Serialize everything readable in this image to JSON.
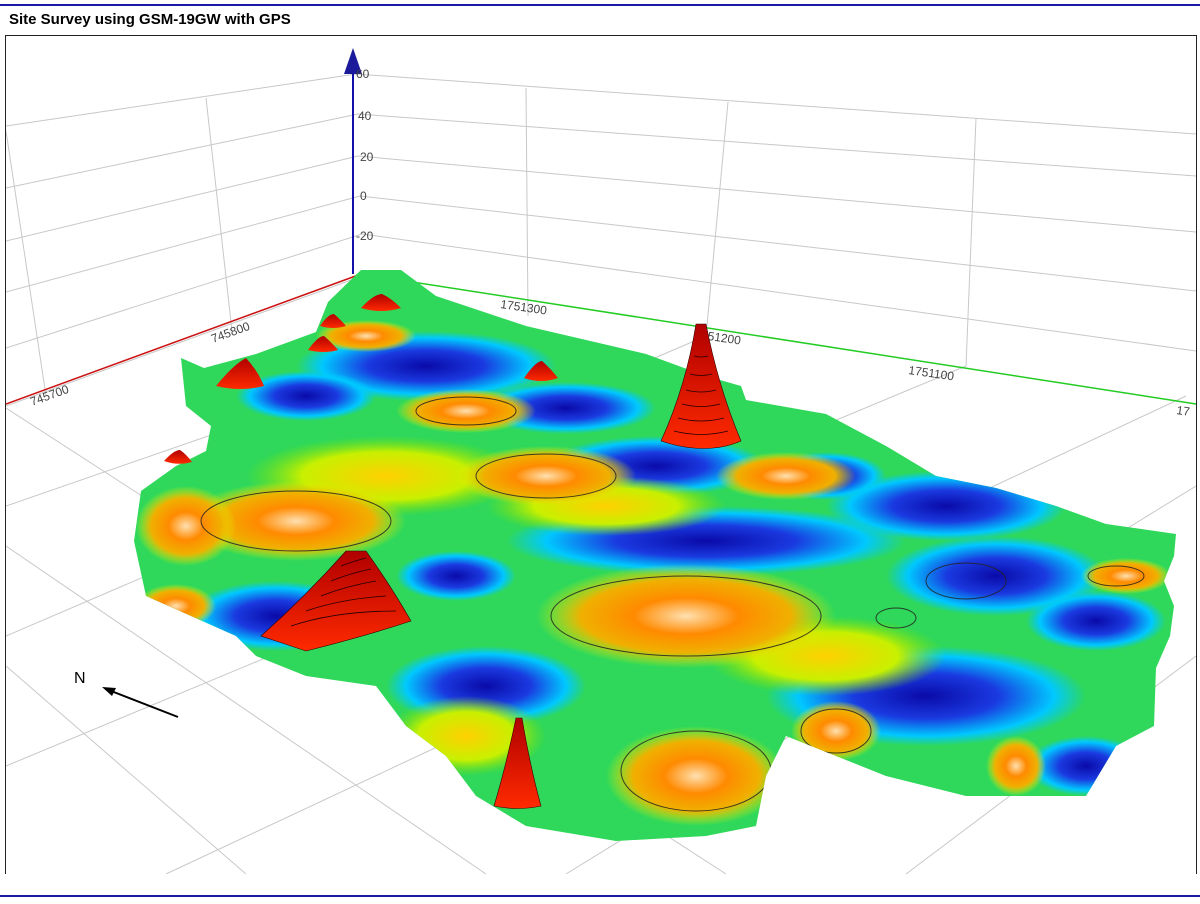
{
  "window": {
    "title": "Site Survey using GSM-19GW with GPS"
  },
  "plot3d": {
    "z_ticks": [
      "60",
      "40",
      "20",
      "0",
      "-20"
    ],
    "x_ticks": [
      "745700",
      "745800"
    ],
    "y_ticks": [
      "1751300",
      "1751200",
      "1751100",
      "17"
    ],
    "compass": {
      "label": "N"
    },
    "colors": {
      "x_axis": "#cc1111",
      "y_axis": "#22cc22",
      "z_axis": "#1111aa",
      "grid": "#c8c8c8",
      "colormap": [
        "#1010c0",
        "#00c8ff",
        "#00e060",
        "#e8f000",
        "#ff8000",
        "#e00000"
      ]
    }
  }
}
